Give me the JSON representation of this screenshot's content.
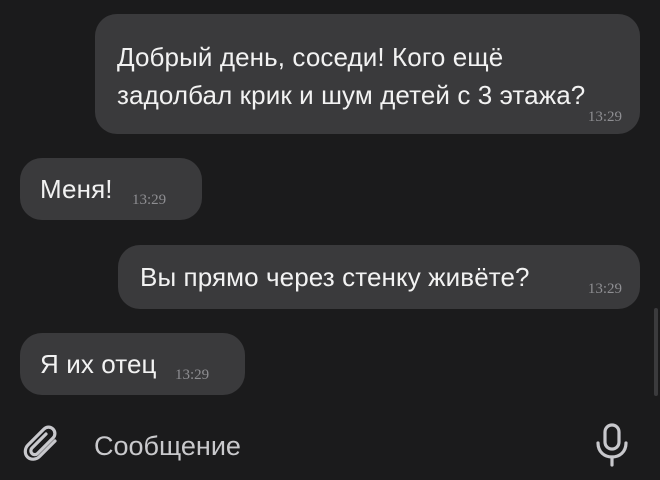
{
  "messages": [
    {
      "direction": "outgoing",
      "lines": [
        "Добрый день, соседи! Кого ещё",
        "задолбал крик и шум детей с 3 этажа?"
      ],
      "time": "13:29"
    },
    {
      "direction": "incoming",
      "text": "Меня!",
      "time": "13:29"
    },
    {
      "direction": "outgoing",
      "text": "Вы прямо через стенку живёте?",
      "time": "13:29"
    },
    {
      "direction": "incoming",
      "text": "Я их отец",
      "time": "13:29"
    }
  ],
  "composer": {
    "placeholder": "Сообщение",
    "attach_icon": "paperclip-icon",
    "mic_icon": "microphone-icon"
  },
  "colors": {
    "background": "#1b1b1c",
    "bubble": "#3a3a3c",
    "text": "#f2f2f2",
    "time": "#8e8e92"
  }
}
